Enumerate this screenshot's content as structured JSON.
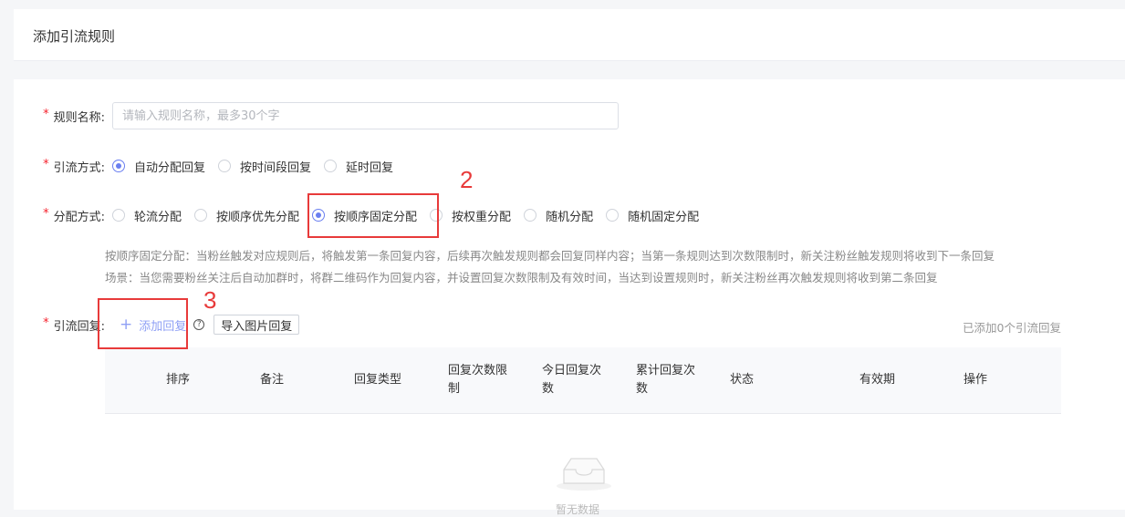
{
  "page": {
    "title": "添加引流规则"
  },
  "form": {
    "rule_name": {
      "label": "规则名称:",
      "placeholder": "请输入规则名称，最多30个字",
      "value": ""
    },
    "diversion_mode": {
      "label": "引流方式:",
      "options": [
        "自动分配回复",
        "按时间段回复",
        "延时回复"
      ],
      "selected": "自动分配回复"
    },
    "allocation_mode": {
      "label": "分配方式:",
      "options": [
        "轮流分配",
        "按顺序优先分配",
        "按顺序固定分配",
        "按权重分配",
        "随机分配",
        "随机固定分配"
      ],
      "selected": "按顺序固定分配",
      "hint_line1": "按顺序固定分配：当粉丝触发对应规则后，将触发第一条回复内容，后续再次触发规则都会回复同样内容；当第一条规则达到次数限制时，新关注粉丝触发规则将收到下一条回复",
      "hint_line2": "场景：当您需要粉丝关注后自动加群时，将群二维码作为回复内容，并设置回复次数限制及有效时间，当达到设置规则时，新关注粉丝再次触发规则将收到第二条回复"
    },
    "replies": {
      "label": "引流回复:",
      "add_label": "添加回复",
      "import_label": "导入图片回复",
      "count_text": "已添加0个引流回复"
    }
  },
  "table": {
    "columns": [
      "排序",
      "备注",
      "回复类型",
      "回复次数限\n制",
      "今日回复次\n数",
      "累计回复次\n数",
      "状态",
      "有效期",
      "操作"
    ],
    "empty_text": "暂无数据"
  },
  "annotations": {
    "box2": "2",
    "box3": "3"
  },
  "colors": {
    "accent": "#6a7ff0",
    "annotation": "#e83a3a",
    "required": "#f5222d"
  },
  "icons": [
    "plus-icon",
    "help-icon",
    "empty-inbox-icon"
  ]
}
